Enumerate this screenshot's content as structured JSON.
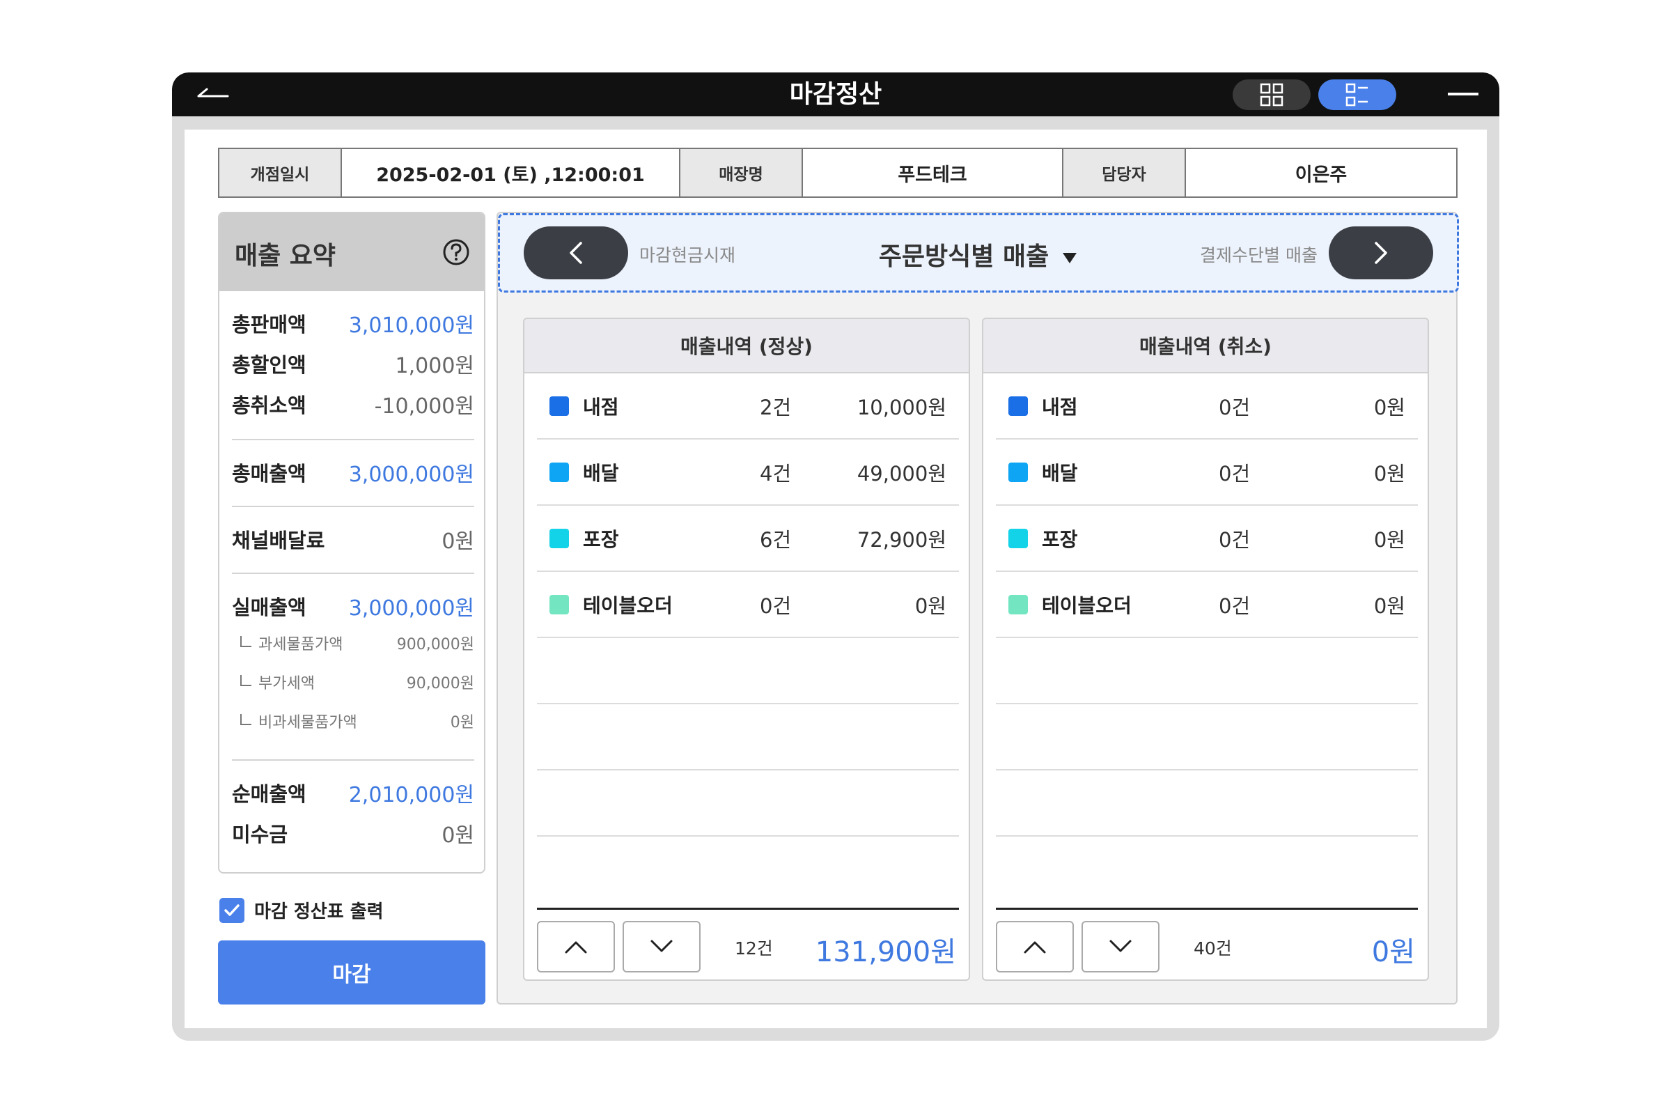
{
  "window": {
    "title": "마감정산",
    "back_icon": "back-arrow-icon",
    "grid_icon": "grid-view-icon",
    "list_icon": "list-view-icon",
    "minimize_icon": "minimize-icon"
  },
  "info": {
    "open_label": "개점일시",
    "open_value": "2025-02-01 (토) ,12:00:01",
    "store_label": "매장명",
    "store_value": "푸드테크",
    "manager_label": "담당자",
    "manager_value": "이은주"
  },
  "summary": {
    "title": "매출 요약",
    "total_sales_label": "총판매액",
    "total_sales": "3,010,000원",
    "total_discount_label": "총할인액",
    "total_discount": "1,000원",
    "total_cancel_label": "총취소액",
    "total_cancel": "-10,000원",
    "gross_label": "총매출액",
    "gross": "3,000,000원",
    "channel_fee_label": "채널배달료",
    "channel_fee": "0원",
    "actual_label": "실매출액",
    "actual": "3,000,000원",
    "taxable_label": "과세물품가액",
    "taxable": "900,000원",
    "vat_label": "부가세액",
    "vat": "90,000원",
    "nontaxable_label": "비과세물품가액",
    "nontaxable": "0원",
    "net_label": "순매출액",
    "net": "2,010,000원",
    "receivable_label": "미수금",
    "receivable": "0원"
  },
  "print_option": {
    "label": "마감 정산표 출력",
    "checked": true
  },
  "close_button": "마감",
  "nav": {
    "prev_label": "마감현금시재",
    "current": "주문방식별 매출",
    "next_label": "결제수단별 매출"
  },
  "normal": {
    "title": "매출내역 (정상)",
    "rows": [
      {
        "name": "내점",
        "count": "2건",
        "amount": "10,000원",
        "color": "#1a6ee6"
      },
      {
        "name": "배달",
        "count": "4건",
        "amount": "49,000원",
        "color": "#0ea5f5"
      },
      {
        "name": "포장",
        "count": "6건",
        "amount": "72,900원",
        "color": "#13d3e8"
      },
      {
        "name": "테이블오더",
        "count": "0건",
        "amount": "0원",
        "color": "#73e6c1"
      }
    ],
    "total_count": "12건",
    "total_amount": "131,900원"
  },
  "cancel": {
    "title": "매출내역 (취소)",
    "rows": [
      {
        "name": "내점",
        "count": "0건",
        "amount": "0원",
        "color": "#1a6ee6"
      },
      {
        "name": "배달",
        "count": "0건",
        "amount": "0원",
        "color": "#0ea5f5"
      },
      {
        "name": "포장",
        "count": "0건",
        "amount": "0원",
        "color": "#13d3e8"
      },
      {
        "name": "테이블오더",
        "count": "0건",
        "amount": "0원",
        "color": "#73e6c1"
      }
    ],
    "total_count": "40건",
    "total_amount": "0원"
  }
}
